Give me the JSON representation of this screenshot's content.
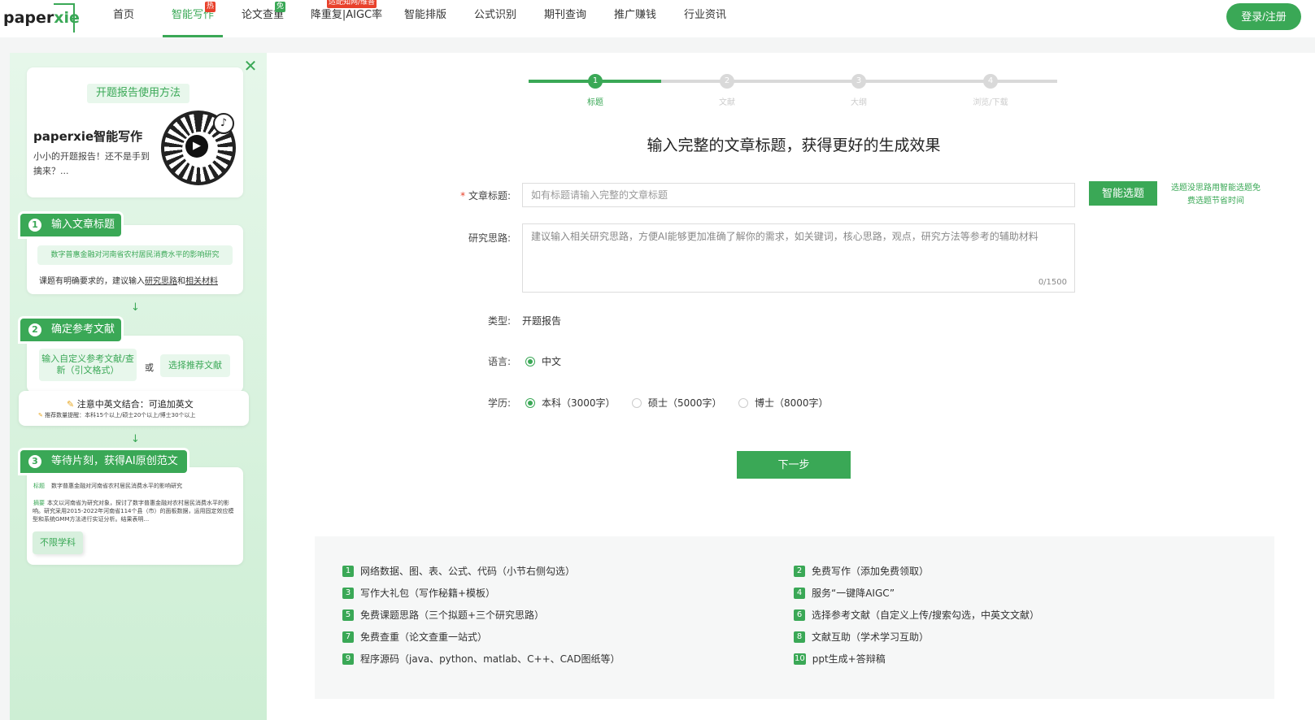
{
  "header": {
    "logo_prefix": "paper",
    "logo_suffix": "xie",
    "nav": [
      {
        "label": "首页",
        "badge": ""
      },
      {
        "label": "智能写作",
        "badge": "热"
      },
      {
        "label": "论文查重",
        "badge": "免"
      },
      {
        "label": "降重复|AIGC率",
        "badge": "适配知网/维普"
      },
      {
        "label": "智能排版",
        "badge": ""
      },
      {
        "label": "公式识别",
        "badge": ""
      },
      {
        "label": "期刊查询",
        "badge": ""
      },
      {
        "label": "推广赚钱",
        "badge": ""
      },
      {
        "label": "行业资讯",
        "badge": ""
      }
    ],
    "login_label": "登录/注册"
  },
  "guide": {
    "howto_label": "开题报告使用方法",
    "brand_title": "paperxie智能写作",
    "brand_desc": "小小的开题报告！还不是手到擒来？...",
    "step1": {
      "num": "1",
      "label": "输入文章标题",
      "example": "数字普惠金融对河南省农村居民消费水平的影响研究",
      "hint_prefix": "课题有明确要求的，建议输入",
      "hint_link1": "研究思路",
      "hint_mid": "和",
      "hint_link2": "相关材料"
    },
    "step2": {
      "num": "2",
      "label": "确定参考文献",
      "option1": "输入自定义参考文献/查新（引文格式）",
      "or": "或",
      "option2": "选择推荐文献",
      "note_main": "注意中英文结合：可追加英文",
      "note_sub": "推荐数量提醒：本科15个以上/硕士20个以上/博士30个以上"
    },
    "step3": {
      "num": "3",
      "label": "等待片刻，获得AI原创范文",
      "sample_title_tag": "标题",
      "sample_title": "数字普惠金融对河南省农村居民消费水平的影响研究",
      "sample_abstract_tag": "摘要",
      "sample_abstract": "本文以河南省为研究对象，探讨了数字普惠金融对农村居民消费水平的影响。研究采用2015-2022年河南省114个县（市）的面板数据，运用固定效应模型和系统GMM方法进行实证分析。结果表明...",
      "subject_label": "不限学科"
    }
  },
  "steps": [
    {
      "num": "1",
      "label": "标题",
      "active": true
    },
    {
      "num": "2",
      "label": "文献",
      "active": false
    },
    {
      "num": "3",
      "label": "大纲",
      "active": false
    },
    {
      "num": "4",
      "label": "浏览/下载",
      "active": false
    }
  ],
  "progress": 0.25,
  "form": {
    "heading": "输入完整的文章标题，获得更好的生成效果",
    "title_label": "文章标题:",
    "title_required_mark": "*",
    "title_placeholder": "如有标题请输入完整的文章标题",
    "title_value": "",
    "smart_button": "智能选题",
    "smart_tip": "选题没思路用智能选题免费选题节省时间",
    "idea_label": "研究思路:",
    "idea_placeholder": "建议输入相关研究思路，方便AI能够更加准确了解你的需求，如关键词，核心思路，观点，研究方法等参考的辅助材料",
    "idea_value": "",
    "char_count": "0/1500",
    "type_label": "类型:",
    "type_value": "开题报告",
    "lang_label": "语言:",
    "lang_options": [
      {
        "label": "中文",
        "checked": true
      }
    ],
    "degree_label": "学历:",
    "degree_options": [
      {
        "label": "本科（3000字）",
        "checked": true
      },
      {
        "label": "硕士（5000字）",
        "checked": false
      },
      {
        "label": "博士（8000字）",
        "checked": false
      }
    ],
    "next_button": "下一步"
  },
  "benefits": [
    {
      "num": "1",
      "text": "网络数据、图、表、公式、代码（小节右侧勾选）"
    },
    {
      "num": "2",
      "text": "免费写作（添加免费领取）"
    },
    {
      "num": "3",
      "text": "写作大礼包（写作秘籍+模板）"
    },
    {
      "num": "4",
      "text": "服务“一键降AIGC”"
    },
    {
      "num": "5",
      "text": "免费课题思路（三个拟题+三个研究思路）"
    },
    {
      "num": "6",
      "text": "选择参考文献（自定义上传/搜索勾选，中英文文献）"
    },
    {
      "num": "7",
      "text": "免费查重（论文查重一站式）"
    },
    {
      "num": "8",
      "text": "文献互助（学术学习互助）"
    },
    {
      "num": "9",
      "text": "程序源码（java、python、matlab、C++、CAD图纸等）"
    },
    {
      "num": "10",
      "text": "ppt生成+答辩稿"
    }
  ],
  "colors": {
    "accent": "#3aa856",
    "hot": "#e8412b"
  }
}
